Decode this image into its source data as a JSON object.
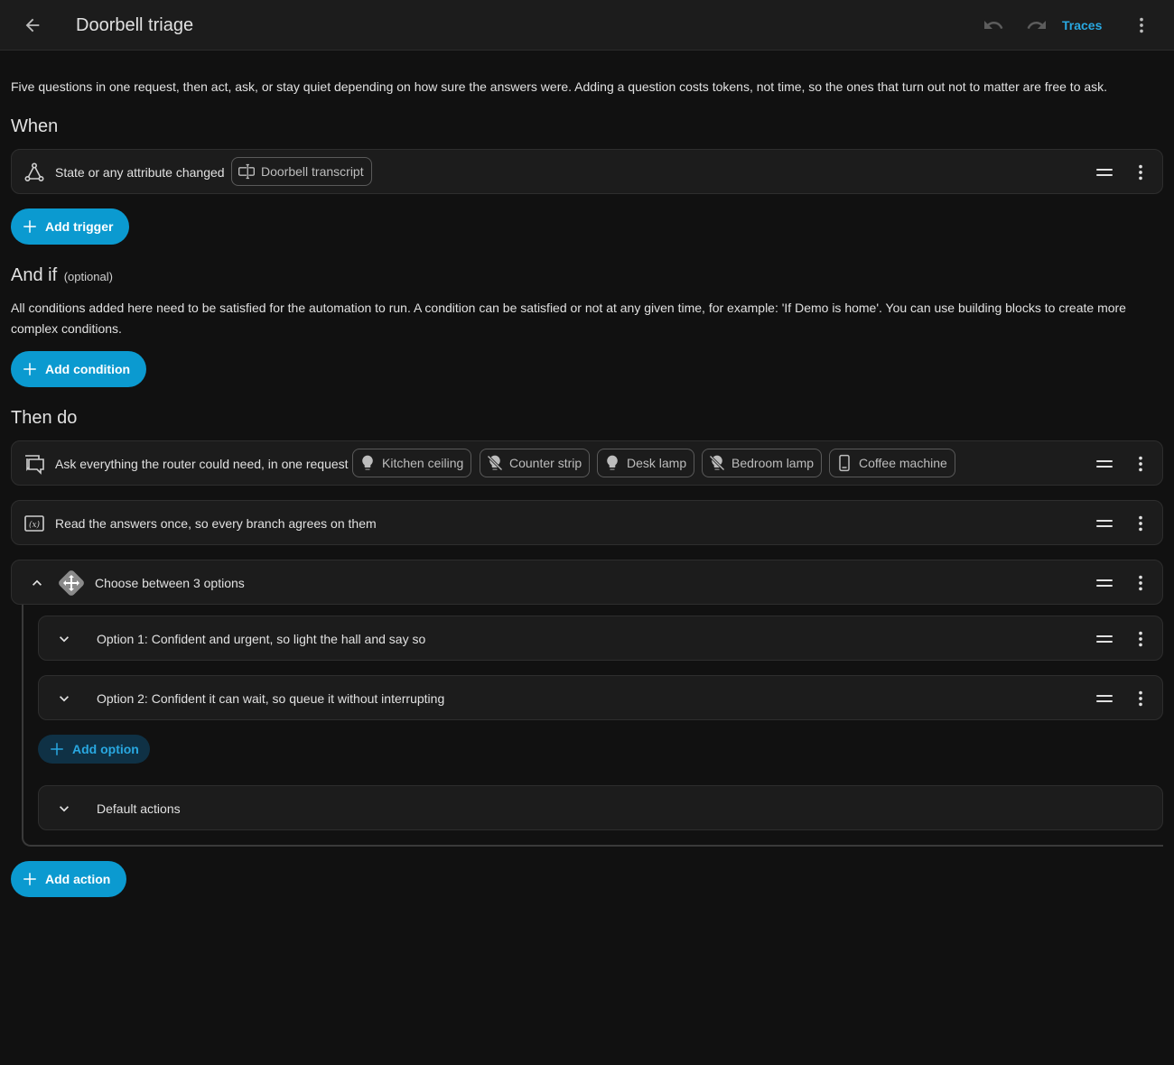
{
  "header": {
    "title": "Doorbell triage",
    "back_icon": "arrow-left-icon",
    "undo_icon": "undo-icon",
    "redo_icon": "redo-icon",
    "traces_label": "Traces",
    "more_icon": "dots-vertical-icon"
  },
  "description": "Five questions in one request, then act, ask, or stay quiet depending on how sure the answers were. Adding a question costs tokens, not time, so the ones that turn out not to matter are free to ask.",
  "when": {
    "title": "When",
    "trigger": {
      "icon": "state-change-icon",
      "label": "State or any attribute changed",
      "entity": {
        "label": "Doorbell transcript",
        "icon": "text-field-icon"
      }
    },
    "add_trigger_label": "Add trigger"
  },
  "and_if": {
    "title": "And if",
    "optional_label": "(optional)",
    "help": "All conditions added here need to be satisfied for the automation to run. A condition can be satisfied or not at any given time, for example: 'If Demo is home'. You can use building blocks to create more complex conditions.",
    "add_condition_label": "Add condition"
  },
  "then_do": {
    "title": "Then do",
    "actions": [
      {
        "icon": "conversation-icon",
        "label": "Ask everything the router could need, in one request",
        "entities": [
          {
            "label": "Kitchen ceiling",
            "icon": "lightbulb-icon"
          },
          {
            "label": "Counter strip",
            "icon": "lightbulb-off-icon"
          },
          {
            "label": "Desk lamp",
            "icon": "lightbulb-icon"
          },
          {
            "label": "Bedroom lamp",
            "icon": "lightbulb-off-icon"
          },
          {
            "label": "Coffee machine",
            "icon": "tablet-icon"
          }
        ]
      },
      {
        "icon": "variable-icon",
        "label": "Read the answers once, so every branch agrees on them"
      },
      {
        "icon": "choose-icon",
        "label": "Choose between 3 options",
        "collapse_icon": "chevron-up-icon",
        "options": [
          {
            "label": "Option 1: Confident and urgent, so light the hall and say so"
          },
          {
            "label": "Option 2: Confident it can wait, so queue it without interrupting"
          }
        ],
        "add_option_label": "Add option",
        "default_label": "Default actions"
      }
    ],
    "add_action_label": "Add action"
  },
  "colors": {
    "background": "#111111",
    "card": "#1c1c1c",
    "accent": "#0b9ad0",
    "link": "#29a8e1"
  }
}
